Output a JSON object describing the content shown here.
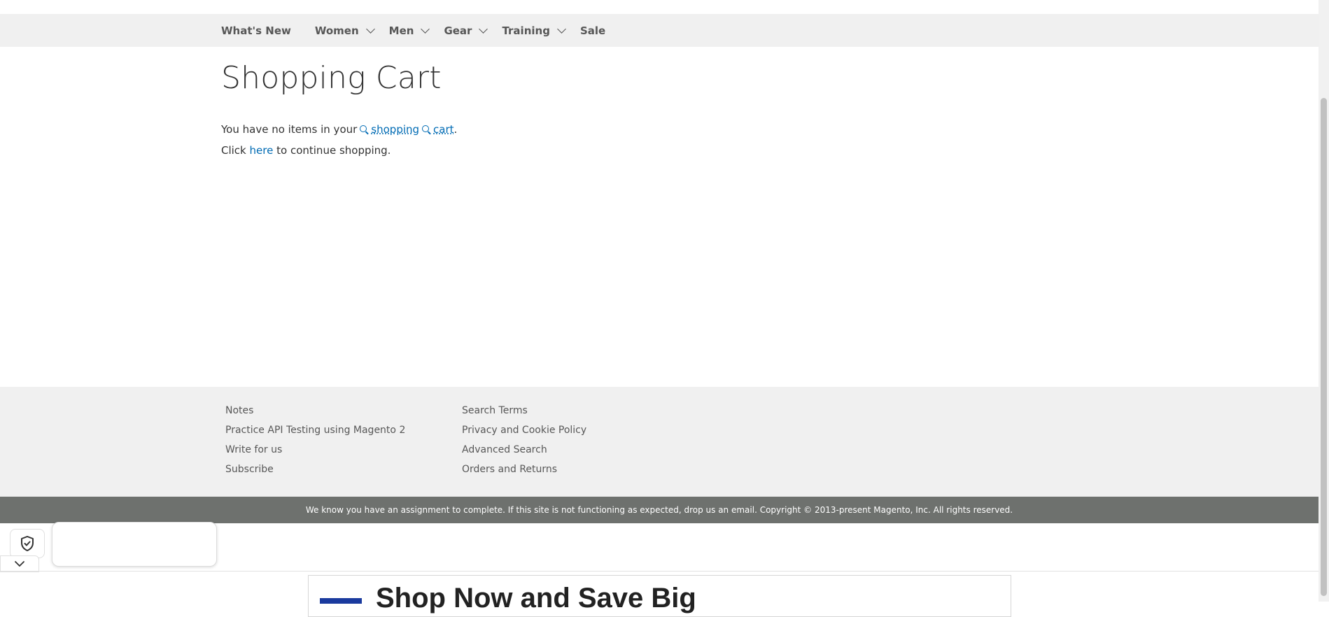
{
  "nav": {
    "items": [
      {
        "label": "What's New",
        "has_menu": false
      },
      {
        "label": "Women",
        "has_menu": true
      },
      {
        "label": "Men",
        "has_menu": true
      },
      {
        "label": "Gear",
        "has_menu": true
      },
      {
        "label": "Training",
        "has_menu": true
      },
      {
        "label": "Sale",
        "has_menu": false
      }
    ]
  },
  "main": {
    "title": "Shopping Cart",
    "empty_message": {
      "prefix": "You have no items in your",
      "link1": "shopping",
      "link2": "cart",
      "suffix": "."
    },
    "continue": {
      "prefix": "Click",
      "link": "here",
      "suffix": "to continue shopping."
    }
  },
  "footer": {
    "col1": [
      "Notes",
      "Practice API Testing using Magento 2",
      "Write for us",
      "Subscribe"
    ],
    "col2": [
      "Search Terms",
      "Privacy and Cookie Policy",
      "Advanced Search",
      "Orders and Returns"
    ],
    "copyright": "We know you have an assignment to complete. If this site is not functioning as expected, drop us an email. Copyright © 2013-present Magento, Inc. All rights reserved."
  },
  "ad": {
    "headline": "Shop Now and Save Big"
  },
  "icons": {
    "privacy_badge": "shield-check-icon",
    "collapse": "chevron-down-icon",
    "link_search": "search-icon"
  },
  "colors": {
    "nav_bg": "#f0f0f0",
    "link": "#006bb4",
    "copyright_bg": "#6e716e",
    "ad_logo": "#1a3a9e"
  }
}
